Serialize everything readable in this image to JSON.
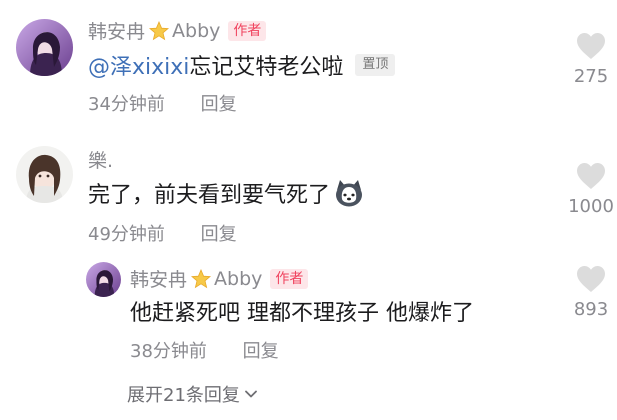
{
  "comments": [
    {
      "username": "韩安冉",
      "username_alt": "Abby",
      "author_badge": "作者",
      "mention": "@泽xixixi",
      "text": " 忘记艾特老公啦",
      "pin_badge": "置顶",
      "time": "34分钟前",
      "reply": "回复",
      "likes": "275"
    },
    {
      "username": "樂.",
      "text": "完了，前夫看到要气死了",
      "time": "49分钟前",
      "reply": "回复",
      "likes": "1000"
    }
  ],
  "reply": {
    "username": "韩安冉",
    "username_alt": "Abby",
    "author_badge": "作者",
    "text": "他赶紧死吧 理都不理孩子 他爆炸了",
    "time": "38分钟前",
    "reply": "回复",
    "likes": "893"
  },
  "expand_label": "展开21条回复",
  "icons": {
    "heart": "heart-icon",
    "star": "star-icon",
    "emoji": "husky-emoji-icon",
    "chevron": "chevron-down-icon"
  },
  "colors": {
    "username": "#8a8a8f",
    "author_badge_bg": "#fde6e9",
    "author_badge_text": "#f0445f",
    "mention": "#3f70b7",
    "heart": "#dcdcdc"
  }
}
